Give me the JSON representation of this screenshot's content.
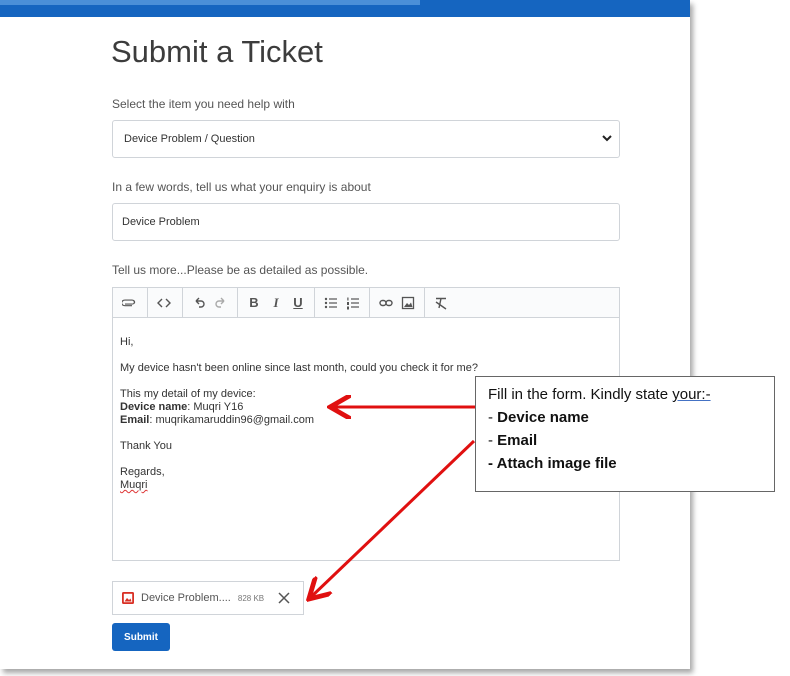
{
  "page": {
    "title": "Submit a Ticket",
    "accent_color": "#1565c0"
  },
  "form": {
    "item_label": "Select the item you need help with",
    "item_value": "Device Problem / Question",
    "subject_label": "In a few words, tell us what your enquiry is about",
    "subject_value": "Device Problem",
    "details_label": "Tell us more...Please be as detailed as possible.",
    "toolbar_icons": [
      "paperclip-icon",
      "code-icon",
      "undo-icon",
      "redo-icon",
      "bold-icon",
      "italic-icon",
      "underline-icon",
      "bullet-list-icon",
      "numbered-list-icon",
      "link-icon",
      "image-icon",
      "clear-format-icon"
    ],
    "message": {
      "greeting": "Hi,",
      "line1": "My device hasn't been online since last month, could you check it for me?",
      "detail_intro": "This my detail of my device:",
      "device_label": "Device name",
      "device_value": ": Muqri Y16",
      "email_label": "Email",
      "email_value": ": muqrikamaruddin96@gmail.com",
      "thanks": "Thank You",
      "regards": "Regards,",
      "signature": "Muqri"
    },
    "attachment": {
      "name": "Device Problem....",
      "size": "828 KB"
    },
    "submit_label": "Submit"
  },
  "callout": {
    "line1_prefix": "Fill in the form. Kindly state ",
    "line1_underlined": "your:-",
    "item1_dash": "- ",
    "item1": "Device name",
    "item2_dash": "- ",
    "item2": "Email",
    "item3": "- Attach image file",
    "arrow_color": "#e01010"
  }
}
